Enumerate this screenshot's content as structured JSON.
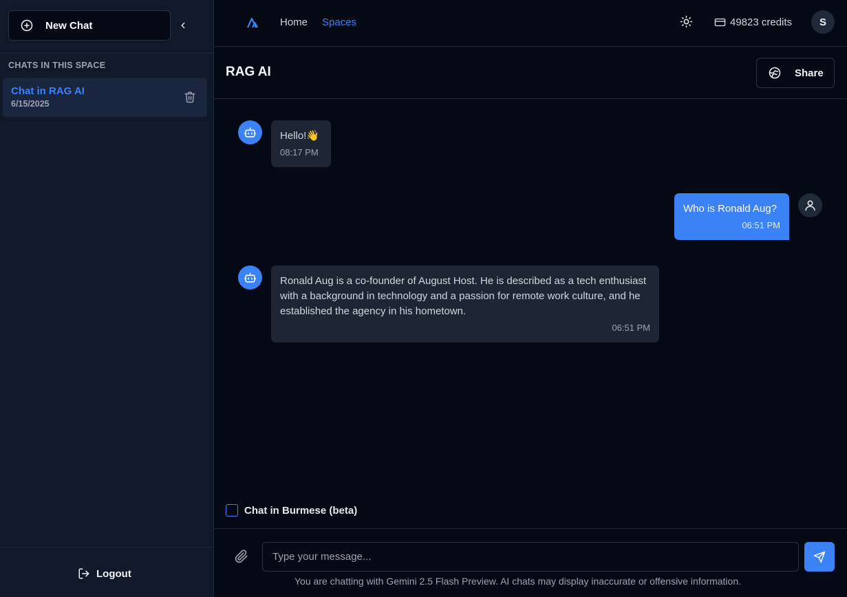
{
  "sidebar": {
    "new_chat_label": "New Chat",
    "section_title": "CHATS IN THIS SPACE",
    "chats": [
      {
        "title": "Chat in RAG AI",
        "date": "6/15/2025"
      }
    ],
    "logout_label": "Logout"
  },
  "topbar": {
    "nav_home": "Home",
    "nav_spaces": "Spaces",
    "credits": "49823 credits",
    "avatar_initial": "S"
  },
  "space": {
    "title": "RAG AI",
    "share_label": "Share"
  },
  "messages": [
    {
      "role": "bot",
      "text": "Hello!👋",
      "time": "08:17 PM"
    },
    {
      "role": "user",
      "text": "Who is Ronald Aug?",
      "time": "06:51 PM"
    },
    {
      "role": "bot",
      "text": "Ronald Aug is a co-founder of August Host. He is described as a tech enthusiast with a background in technology and a passion for remote work culture, and he established the agency in his hometown.",
      "time": "06:51 PM"
    }
  ],
  "composer": {
    "burmese_label": "Chat in Burmese (beta)",
    "placeholder": "Type your message...",
    "value": "",
    "disclaimer": "You are chatting with Gemini 2.5 Flash Preview. AI chats may display inaccurate or offensive information."
  },
  "colors": {
    "accent": "#3b82f6",
    "background": "#050914",
    "sidebar": "#111827",
    "bot_bubble": "#1f2633"
  },
  "icons": {
    "new_chat": "plus-circle-icon",
    "collapse": "chevron-left-icon",
    "trash": "trash-icon",
    "logout": "logout-icon",
    "theme": "sun-icon",
    "credits": "credit-card-icon",
    "share": "globe-icon",
    "bot": "bot-icon",
    "user": "user-icon",
    "attach": "paperclip-icon",
    "send": "send-icon"
  }
}
